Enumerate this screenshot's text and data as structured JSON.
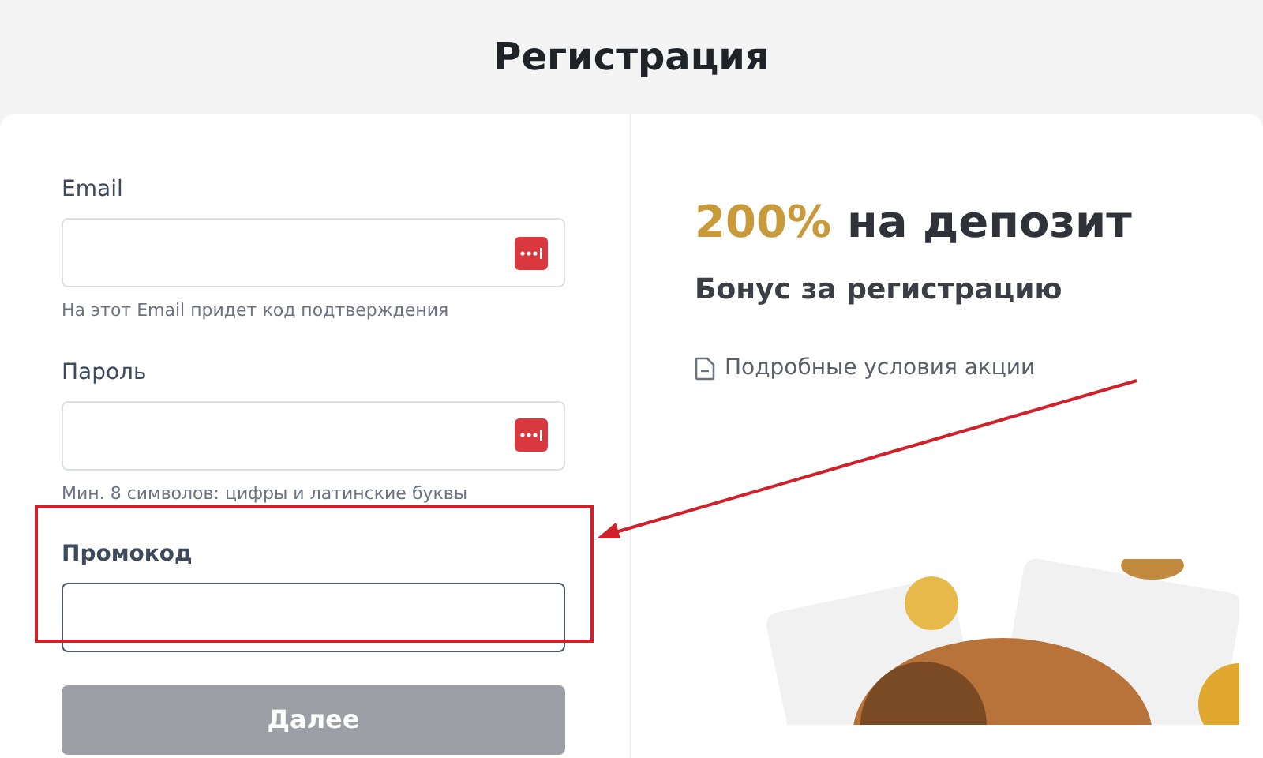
{
  "page_title": "Регистрация",
  "form": {
    "fields": [
      {
        "label": "Email",
        "hint": "На этот Email придет код подтверждения",
        "kind": "keyed",
        "focused": false
      },
      {
        "label": "Пароль",
        "hint": "Мин. 8 символов: цифры и латинские буквы",
        "kind": "keyed",
        "focused": false
      },
      {
        "label": "Промокод",
        "kind": "plain",
        "focused": true
      }
    ],
    "submit": {
      "label": "Далее",
      "disabled": true
    }
  },
  "promo": {
    "highlight": "200%",
    "headline": "на депозит",
    "subtitle": "Бонус за регистрацию",
    "terms_link": "Подробные условия акции"
  }
}
